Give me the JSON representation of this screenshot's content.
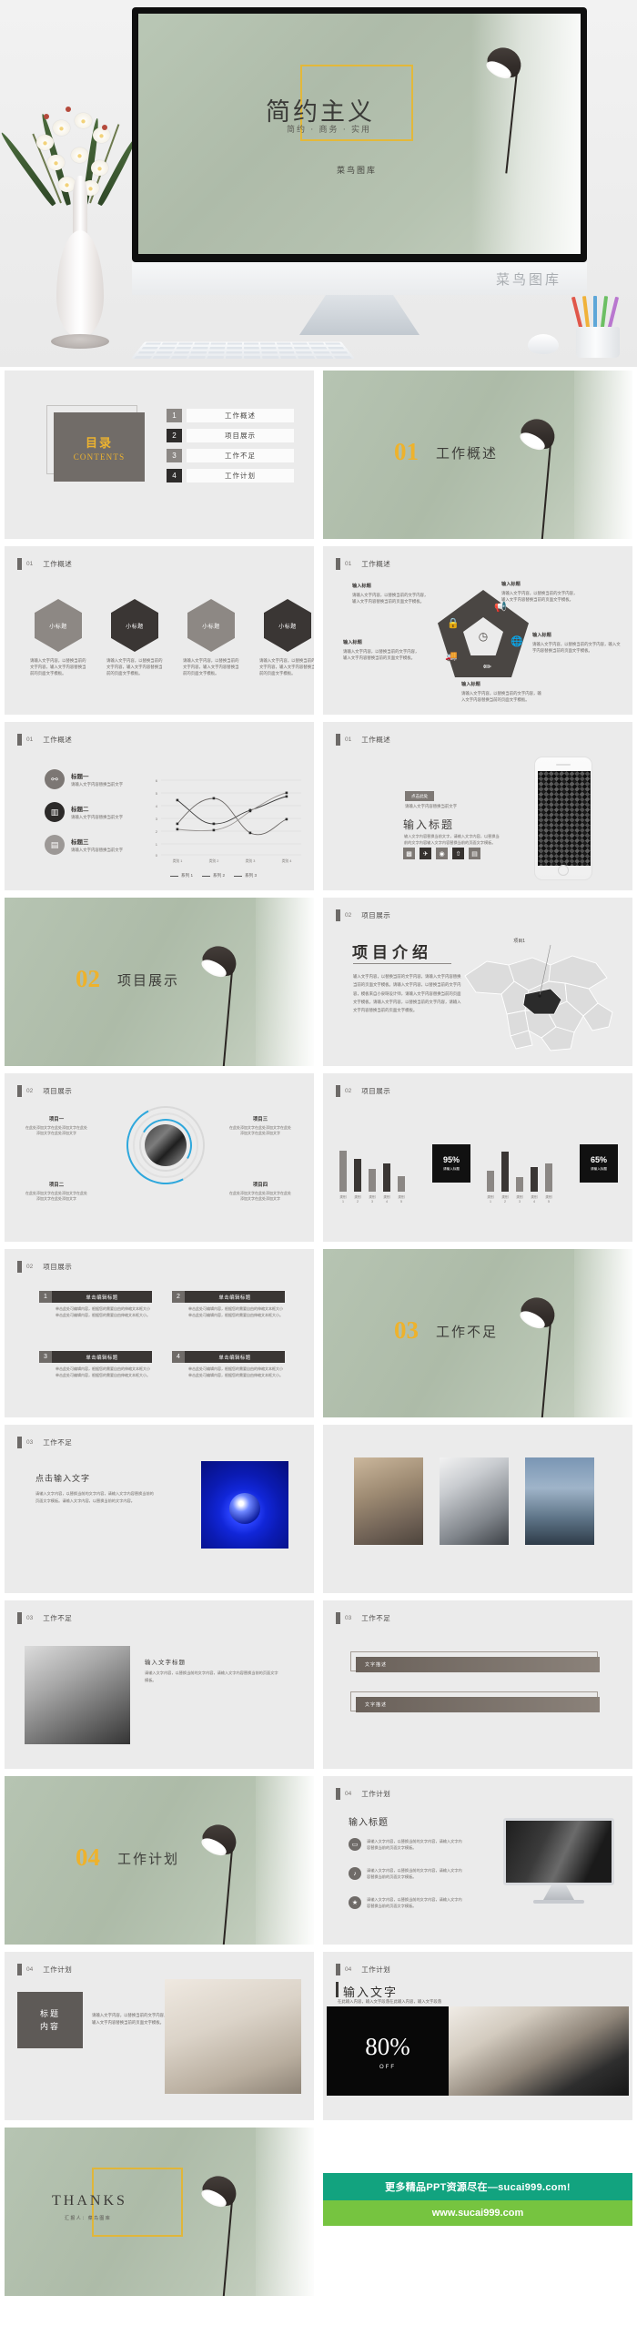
{
  "cover": {
    "title": "简约主义",
    "subtitle": "简约 · 商务 · 实用",
    "brand": "菜鸟图库",
    "watermark": "菜鸟图库"
  },
  "toc": {
    "cn": "目录",
    "en": "CONTENTS",
    "items": [
      {
        "index": "1",
        "label": "工作概述"
      },
      {
        "index": "2",
        "label": "项目展示"
      },
      {
        "index": "3",
        "label": "工作不足"
      },
      {
        "index": "4",
        "label": "工作计划"
      }
    ]
  },
  "sections": [
    {
      "num": "01",
      "title": "工作概述"
    },
    {
      "num": "02",
      "title": "项目展示"
    },
    {
      "num": "03",
      "title": "工作不足"
    },
    {
      "num": "04",
      "title": "工作计划"
    }
  ],
  "headers": {
    "s01": {
      "num": "01",
      "text": "工作概述"
    },
    "s02": {
      "num": "02",
      "text": "项目展示"
    },
    "s03": {
      "num": "03",
      "text": "工作不足"
    },
    "s04": {
      "num": "04",
      "text": "工作计划"
    }
  },
  "common": {
    "sub_title": "小标题",
    "input_title": "输入标题",
    "body_short": "请输入文字内容，以替换当前的文字内容，输入文字内容替换当前的页面文字模板。",
    "body_mid": "请输入文字内容，以替换当前的文字内容，输入文字内容替换当前的页面文字模板。",
    "body_long": "单击此处可编辑内容，根据您的需要自由的伸缩文本框大小单击此处可编辑内容，根据您的需要自由伸缩文本框大小。",
    "click_edit_title": "单击编辑标题"
  },
  "hexagons": {
    "items": [
      {
        "label": "小标题",
        "tone": "lite",
        "desc": "请输入文字内容，以替换当前的文字内容，输入文字内容替换当前的页面文字模板。"
      },
      {
        "label": "小标题",
        "tone": "dark",
        "desc": "请输入文字内容，以替换当前的文字内容，输入文字内容替换当前的页面文字模板。"
      },
      {
        "label": "小标题",
        "tone": "lite",
        "desc": "请输入文字内容，以替换当前的文字内容，输入文字内容替换当前的页面文字模板。"
      },
      {
        "label": "小标题",
        "tone": "dark",
        "desc": "请输入文字内容，以替换当前的文字内容，输入文字内容替换当前的页面文字模板。"
      }
    ]
  },
  "pentagon": {
    "notes": [
      {
        "title": "输入标题",
        "desc": "请输入文字内容，以替换当前的文字内容，输入文字内容替换当前的页面文字模板。"
      },
      {
        "title": "输入标题",
        "desc": "请输入文字内容，以替换当前的文字内容，输入文字内容替换当前的页面文字模板。"
      },
      {
        "title": "输入标题",
        "desc": "请输入文字内容，以替换当前的文字内容，输入文字内容替换当前的页面文字模板。"
      },
      {
        "title": "输入标题",
        "desc": "请输入文字内容，以替换当前的文字内容，输入文字内容替换当前的页面文字模板。"
      },
      {
        "title": "输入标题",
        "desc": "请输入文字内容，以替换当前的文字内容，输入文字内容替换当前的页面文字模板。"
      }
    ],
    "icons": [
      "lock-icon",
      "megaphone-icon",
      "globe-icon",
      "pencil-icon",
      "truck-icon",
      "clock-icon"
    ]
  },
  "line_slide": {
    "items": [
      {
        "title": "标题一",
        "desc": "请输入文字内容替换当前文字",
        "icon": "people-icon"
      },
      {
        "title": "标题二",
        "desc": "请输入文字内容替换当前文字",
        "icon": "chart-icon"
      },
      {
        "title": "标题三",
        "desc": "请输入文字内容替换当前文字",
        "icon": "cart-icon"
      }
    ]
  },
  "phone_slide": {
    "tag": "点击此处",
    "tag_sub": "请输入文字内容替换当前文字",
    "title": "输入标题",
    "body": "输入文字内容替换当前文字，请输入文字内容，以替换当前的文字内容输入文字内容替换当前的页面文字模板。",
    "icons": [
      "image-icon",
      "rocket-icon",
      "camera-icon",
      "upload-icon",
      "chart-icon"
    ]
  },
  "map_slide": {
    "title": "项目介绍",
    "body": "输入文字内容，以替换当前的文字内容，请输入文字内容替换当前的页面文字模板。请输入文字内容，以替换当前的文字内容，模板来自小泉呀设计师，请输入文字内容替换当前的页面文字模板。请输入文字内容，以替换当前的文字内容，请输入文字内容替换当前的页面文字模板。",
    "pin_label": "项目1"
  },
  "circle_slide": {
    "notes": [
      {
        "title": "项目一",
        "desc": "在此处添加文字在此处添加文字在此处添加文字在此处添加文字"
      },
      {
        "title": "项目二",
        "desc": "在此处添加文字在此处添加文字在此处添加文字在此处添加文字"
      },
      {
        "title": "项目三",
        "desc": "在此处添加文字在此处添加文字在此处添加文字在此处添加文字"
      },
      {
        "title": "项目四",
        "desc": "在此处添加文字在此处添加文字在此处添加文字在此处添加文字"
      }
    ]
  },
  "numbered_slide": {
    "items": [
      {
        "index": "1",
        "title": "单击编辑标题",
        "desc": "单击此处可编辑内容，根据您的需要自由的伸缩文本框大小单击此处可编辑内容，根据您的需要自由伸缩文本框大小。"
      },
      {
        "index": "2",
        "title": "单击编辑标题",
        "desc": "单击此处可编辑内容，根据您的需要自由的伸缩文本框大小单击此处可编辑内容，根据您的需要自由伸缩文本框大小。"
      },
      {
        "index": "3",
        "title": "单击编辑标题",
        "desc": "单击此处可编辑内容，根据您的需要自由的伸缩文本框大小单击此处可编辑内容，根据您的需要自由伸缩文本框大小。"
      },
      {
        "index": "4",
        "title": "单击编辑标题",
        "desc": "单击此处可编辑内容，根据您的需要自由的伸缩文本框大小单击此处可编辑内容，根据您的需要自由伸缩文本框大小。"
      }
    ]
  },
  "text_image_slide": {
    "title": "点击输入文字",
    "body": "请输入文字内容，以替换当前的文字内容，请输入文字内容替换当前的页面文字模板。请输入文字内容，以替换当前的文字内容。"
  },
  "gray_photo_slide": {
    "title": "输入文字标题",
    "body": "请输入文字内容，以替换当前的文字内容，请输入文字内容替换当前的页面文字模板。"
  },
  "brownbar_slide": {
    "rows": [
      {
        "label": "文字描述"
      },
      {
        "label": "文字描述"
      }
    ]
  },
  "imac_slide": {
    "title": "输入标题",
    "bullets": [
      {
        "icon": "laptop-icon",
        "text": "请输入文字内容，以替换当前的文字内容，请输入文字内容替换当前的页面文字模板。"
      },
      {
        "icon": "music-icon",
        "text": "请输入文字内容，以替换当前的文字内容，请输入文字内容替换当前的页面文字模板。"
      },
      {
        "icon": "star-icon",
        "text": "请输入文字内容，以替换当前的文字内容，请输入文字内容替换当前的页面文字模板。"
      }
    ]
  },
  "plan_slide": {
    "box_line1": "标题",
    "box_line2": "内容",
    "text": "请输入文字内容，以替换当前的文字内容，请输入文字内容替换当前的页面文字模板。"
  },
  "eighty_slide": {
    "title": "输入文字",
    "subtitle": "在此输入内容，输入文字段落在此输入内容，输入文字段落",
    "percent": "80%",
    "off": "OFF"
  },
  "thanks": {
    "title": "THANKS",
    "subtitle": "汇报人：菜鸟图库"
  },
  "promo": {
    "line1": "更多精品PPT资源尽在—sucai999.com!",
    "line2": "www.sucai999.com"
  },
  "colors": {
    "gold": "#eeb22c",
    "green_bg": "#b3c0af",
    "dark": "#2d2b2a",
    "mid_gray": "#8b8784",
    "promo_teal": "#12a37f",
    "promo_green": "#76c440"
  },
  "chart_data": [
    {
      "type": "line",
      "title": "",
      "categories": [
        "类别 1",
        "类别 2",
        "类别 3",
        "类别 4"
      ],
      "series": [
        {
          "name": "系列 1",
          "values": [
            4.3,
            2.5,
            3.5,
            4.5
          ]
        },
        {
          "name": "系列 2",
          "values": [
            2.4,
            4.4,
            1.8,
            2.8
          ]
        },
        {
          "name": "系列 3",
          "values": [
            2.0,
            2.0,
            3.0,
            5.0
          ]
        }
      ],
      "ylim": [
        0,
        6
      ],
      "yticks": [
        0,
        1,
        2,
        3,
        4,
        5,
        6
      ],
      "xlabel": "",
      "ylabel": "",
      "grid": true,
      "legend": "bottom"
    },
    {
      "type": "bar",
      "title": "",
      "categories": [
        "类别1",
        "类别2",
        "类别3",
        "类别4",
        "类别5"
      ],
      "values": [
        4.3,
        3.4,
        2.4,
        3.0,
        1.6
      ],
      "ylim": [
        0,
        5
      ],
      "callout": {
        "percent": "95%",
        "label": "请输入标题"
      }
    },
    {
      "type": "bar",
      "title": "",
      "categories": [
        "类别1",
        "类别2",
        "类别3",
        "类别4",
        "类别5"
      ],
      "values": [
        2.2,
        4.3,
        1.5,
        2.6,
        3.0
      ],
      "ylim": [
        0,
        5
      ],
      "callout": {
        "percent": "65%",
        "label": "请输入标题"
      }
    }
  ]
}
